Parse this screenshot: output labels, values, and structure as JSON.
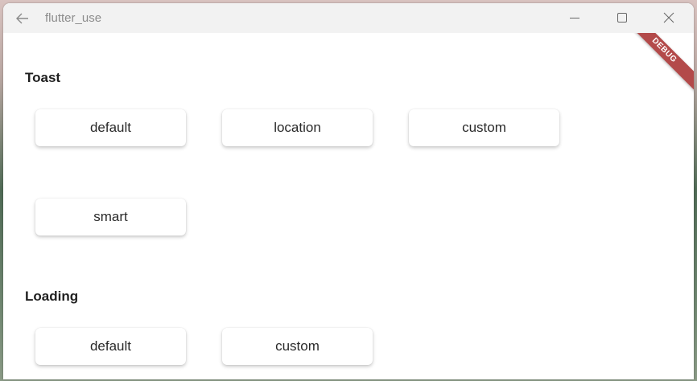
{
  "window": {
    "title": "flutter_use"
  },
  "banner": "DEBUG",
  "sections": [
    {
      "title": "Toast",
      "buttons": [
        "default",
        "location",
        "custom",
        "smart"
      ]
    },
    {
      "title": "Loading",
      "buttons": [
        "default",
        "custom"
      ]
    }
  ]
}
